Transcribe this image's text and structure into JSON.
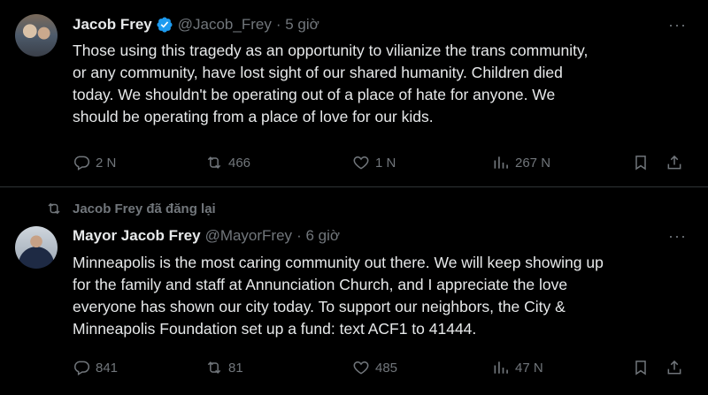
{
  "tweets": [
    {
      "author_name": "Jacob Frey",
      "verified": true,
      "handle": "@Jacob_Frey",
      "time": "· 5 giờ",
      "more": "···",
      "lines": [
        "Those using this tragedy as an opportunity to vilianize the trans community,",
        "or any community, have lost sight of our shared humanity. Children died",
        "today. We shouldn't be operating out of a place of hate for anyone. We",
        "should be operating from a place of love for our kids."
      ],
      "replies": "2 N",
      "retweets": "466",
      "likes": "1 N",
      "views": "267 N"
    },
    {
      "repost_label": "Jacob Frey đã đăng lại",
      "author_name": "Mayor Jacob Frey",
      "handle": "@MayorFrey",
      "time": "· 6 giờ",
      "more": "···",
      "lines": [
        "Minneapolis is the most caring community out there. We will keep showing up",
        "for the family and staff at Annunciation Church, and I appreciate the love",
        "everyone has shown our city today. To support our neighbors, the City &",
        "Minneapolis Foundation set up a fund: text ACF1 to 41444."
      ],
      "replies": "841",
      "retweets": "81",
      "likes": "485",
      "views": "47 N"
    }
  ],
  "colors": {
    "background": "#000000",
    "text": "#e7e9ea",
    "muted": "#71767b",
    "divider": "#2f3336",
    "verified": "#1d9bf0"
  },
  "icons": [
    "reply-icon",
    "retweet-icon",
    "like-icon",
    "views-icon",
    "bookmark-icon",
    "share-icon",
    "verified-badge-icon",
    "more-icon"
  ]
}
